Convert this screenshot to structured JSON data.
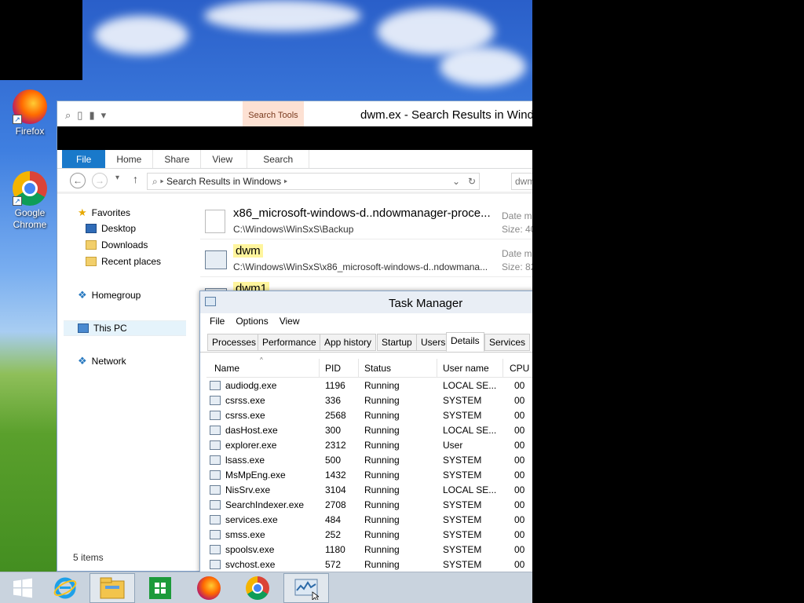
{
  "desktop": {
    "icons": [
      {
        "label": "Firefox"
      },
      {
        "label": "Google Chrome"
      }
    ]
  },
  "explorer": {
    "title": "dwm.ex - Search Results in Windo",
    "search_tools": "Search Tools",
    "tabs": [
      "File",
      "Home",
      "Share",
      "View",
      "Search"
    ],
    "address": "Search Results in Windows",
    "search_value": "dwm",
    "nav": {
      "favorites": "Favorites",
      "desktop": "Desktop",
      "downloads": "Downloads",
      "recent": "Recent places",
      "homegroup": "Homegroup",
      "thispc": "This PC",
      "network": "Network"
    },
    "results": [
      {
        "name": "x86_microsoft-windows-d..ndowmanager-proce...",
        "path": "C:\\Windows\\WinSxS\\Backup",
        "meta1": "Date m",
        "meta2": "Size: 40"
      },
      {
        "name": "dwm",
        "path": "C:\\Windows\\WinSxS\\x86_microsoft-windows-d..ndowmana...",
        "meta1": "Date m",
        "meta2": "Size: 82"
      },
      {
        "name": "dwm1",
        "path": "",
        "meta1": "",
        "meta2": ""
      }
    ],
    "status": "5 items"
  },
  "taskmgr": {
    "title": "Task Manager",
    "menu": [
      "File",
      "Options",
      "View"
    ],
    "tabs": [
      "Processes",
      "Performance",
      "App history",
      "Startup",
      "Users",
      "Details",
      "Services"
    ],
    "columns": {
      "name": "Name",
      "pid": "PID",
      "status": "Status",
      "user": "User name",
      "cpu": "CPU"
    },
    "rows": [
      {
        "name": "audiodg.exe",
        "pid": "1196",
        "status": "Running",
        "user": "LOCAL SE...",
        "cpu": "00"
      },
      {
        "name": "csrss.exe",
        "pid": "336",
        "status": "Running",
        "user": "SYSTEM",
        "cpu": "00"
      },
      {
        "name": "csrss.exe",
        "pid": "2568",
        "status": "Running",
        "user": "SYSTEM",
        "cpu": "00"
      },
      {
        "name": "dasHost.exe",
        "pid": "300",
        "status": "Running",
        "user": "LOCAL SE...",
        "cpu": "00"
      },
      {
        "name": "explorer.exe",
        "pid": "2312",
        "status": "Running",
        "user": "User",
        "cpu": "00"
      },
      {
        "name": "lsass.exe",
        "pid": "500",
        "status": "Running",
        "user": "SYSTEM",
        "cpu": "00"
      },
      {
        "name": "MsMpEng.exe",
        "pid": "1432",
        "status": "Running",
        "user": "SYSTEM",
        "cpu": "00"
      },
      {
        "name": "NisSrv.exe",
        "pid": "3104",
        "status": "Running",
        "user": "LOCAL SE...",
        "cpu": "00"
      },
      {
        "name": "SearchIndexer.exe",
        "pid": "2708",
        "status": "Running",
        "user": "SYSTEM",
        "cpu": "00"
      },
      {
        "name": "services.exe",
        "pid": "484",
        "status": "Running",
        "user": "SYSTEM",
        "cpu": "00"
      },
      {
        "name": "smss.exe",
        "pid": "252",
        "status": "Running",
        "user": "SYSTEM",
        "cpu": "00"
      },
      {
        "name": "spoolsv.exe",
        "pid": "1180",
        "status": "Running",
        "user": "SYSTEM",
        "cpu": "00"
      },
      {
        "name": "svchost.exe",
        "pid": "572",
        "status": "Running",
        "user": "SYSTEM",
        "cpu": "00"
      }
    ]
  },
  "taskbar": {
    "items": [
      "start-icon",
      "ie-icon",
      "file-explorer-icon",
      "store-icon",
      "firefox-icon",
      "chrome-icon",
      "task-manager-icon"
    ]
  }
}
